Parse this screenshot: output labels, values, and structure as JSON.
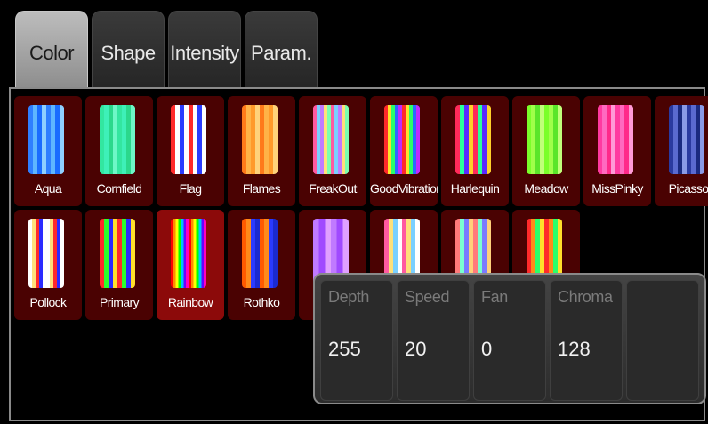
{
  "tabs": [
    {
      "label": "Color",
      "active": true
    },
    {
      "label": "Shape",
      "active": false
    },
    {
      "label": "Intensity",
      "active": false
    },
    {
      "label": "Param.",
      "active": false
    }
  ],
  "effects": [
    {
      "label": "Aqua",
      "selected": false,
      "colors": [
        "#2f7fff",
        "#5fb6ff",
        "#1a6cff",
        "#8fd0ff"
      ]
    },
    {
      "label": "Cornfield",
      "selected": false,
      "colors": [
        "#33e6a0",
        "#3ef0b8",
        "#2bd88c",
        "#6ef7c7"
      ]
    },
    {
      "label": "Flag",
      "selected": false,
      "colors": [
        "#ff2a2a",
        "#ffffff",
        "#2a3cff",
        "#ffffff"
      ]
    },
    {
      "label": "Flames",
      "selected": false,
      "colors": [
        "#ff7a1a",
        "#ffb347",
        "#ff9a2a",
        "#ffd27a"
      ]
    },
    {
      "label": "FreakOut",
      "selected": false,
      "colors": [
        "#ff5aa0",
        "#7ad0ff",
        "#c07aff",
        "#ffe07a",
        "#7affb0"
      ]
    },
    {
      "label": "GoodVibrations",
      "selected": false,
      "colors": [
        "#ff2a2a",
        "#ffe02a",
        "#2aff6a",
        "#2a6aff",
        "#c02aff"
      ]
    },
    {
      "label": "Harlequin",
      "selected": false,
      "colors": [
        "#ff2a5a",
        "#2aff9a",
        "#5a2aff",
        "#ffd02a"
      ]
    },
    {
      "label": "Meadow",
      "selected": false,
      "colors": [
        "#7aff2a",
        "#a0ff4a",
        "#5ae62a",
        "#c0ff7a"
      ]
    },
    {
      "label": "MissPinky",
      "selected": false,
      "colors": [
        "#ff3aa0",
        "#ff6ac0",
        "#ff2a8a",
        "#ff9ad6"
      ]
    },
    {
      "label": "Picasso",
      "selected": false,
      "colors": [
        "#2a3aa0",
        "#5a6ad0",
        "#1a2a80",
        "#8a9ae6"
      ]
    },
    {
      "label": "Pollock",
      "selected": false,
      "colors": [
        "#ffffff",
        "#ffe07a",
        "#ff2a2a",
        "#2a2aff",
        "#ffffff"
      ]
    },
    {
      "label": "Primary",
      "selected": false,
      "colors": [
        "#ff2a2a",
        "#2aff2a",
        "#2a2aff",
        "#ffe02a"
      ]
    },
    {
      "label": "Rainbow",
      "selected": true,
      "colors": [
        "#ff0000",
        "#ff8a00",
        "#ffff00",
        "#00ff00",
        "#00c0ff",
        "#6a00ff",
        "#ff00c0"
      ]
    },
    {
      "label": "Rothko",
      "selected": false,
      "colors": [
        "#ff5a00",
        "#ff8a1a",
        "#2a3aff",
        "#1a2ad0"
      ]
    },
    {
      "label": "",
      "selected": false,
      "colors": [
        "#c07aff",
        "#a04aff",
        "#e0a0ff"
      ]
    },
    {
      "label": "",
      "selected": false,
      "colors": [
        "#ff5aa0",
        "#ffe07a",
        "#7ad0ff",
        "#ffffff"
      ]
    },
    {
      "label": "",
      "selected": false,
      "colors": [
        "#ff7a7a",
        "#7affd0",
        "#7a7aff",
        "#ffd07a"
      ]
    },
    {
      "label": "",
      "selected": false,
      "colors": [
        "#ff2a2a",
        "#ff8a1a",
        "#2aff6a",
        "#ffe02a"
      ]
    }
  ],
  "params": [
    {
      "label": "Depth",
      "value": "255"
    },
    {
      "label": "Speed",
      "value": "20"
    },
    {
      "label": "Fan",
      "value": "0"
    },
    {
      "label": "Chroma",
      "value": "128"
    },
    {
      "label": "",
      "value": ""
    }
  ]
}
